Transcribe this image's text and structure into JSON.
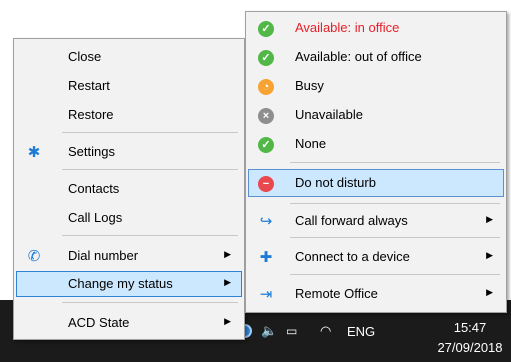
{
  "main_menu": {
    "close": "Close",
    "restart": "Restart",
    "restore": "Restore",
    "settings": "Settings",
    "contacts": "Contacts",
    "call_logs": "Call Logs",
    "dial_number": "Dial number",
    "change_status": "Change my status",
    "acd_state": "ACD State"
  },
  "status_menu": {
    "available_office": "Available: in office",
    "available_out": "Available: out of office",
    "busy": "Busy",
    "unavailable": "Unavailable",
    "none": "None",
    "dnd": "Do not disturb",
    "call_forward": "Call forward always",
    "connect_device": "Connect to a device",
    "remote_office": "Remote Office"
  },
  "taskbar": {
    "language": "ENG",
    "time": "15:47",
    "date": "27/09/2018"
  },
  "icons": {
    "settings": "gear-icon",
    "dial": "phone-icon",
    "available": "check-circle-icon",
    "busy": "clock-circle-icon",
    "unavailable": "x-circle-icon",
    "dnd": "minus-circle-icon",
    "forward": "phone-forward-icon",
    "connect": "phone-plus-icon",
    "remote": "exit-arrow-icon"
  },
  "colors": {
    "available_text": "#e8202a",
    "highlight": "#cce8ff",
    "highlight_border": "#2f83d6"
  }
}
